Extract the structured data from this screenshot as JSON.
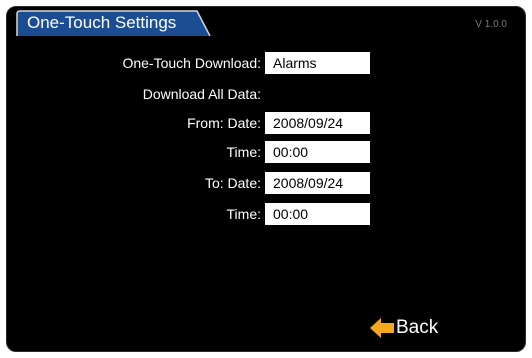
{
  "header": {
    "title": "One-Touch Settings",
    "version": "V 1.0.0"
  },
  "form": {
    "download_label": "One-Touch Download:",
    "download_value": "Alarms",
    "all_data_label": "Download All Data:",
    "from_date_label": "From: Date:",
    "from_date_value": "2008/09/24",
    "from_time_label": "Time:",
    "from_time_value": "00:00",
    "to_date_label": "To: Date:",
    "to_date_value": "2008/09/24",
    "to_time_label": "Time:",
    "to_time_value": "00:00"
  },
  "footer": {
    "back_label": "Back",
    "back_icon": "arrow-left-icon"
  },
  "colors": {
    "background": "#000000",
    "tab_fill": "#1c4d92",
    "text": "#ffffff",
    "field": "#ffffff",
    "arrow": "#f5a81e",
    "version": "#7a7a7a"
  }
}
